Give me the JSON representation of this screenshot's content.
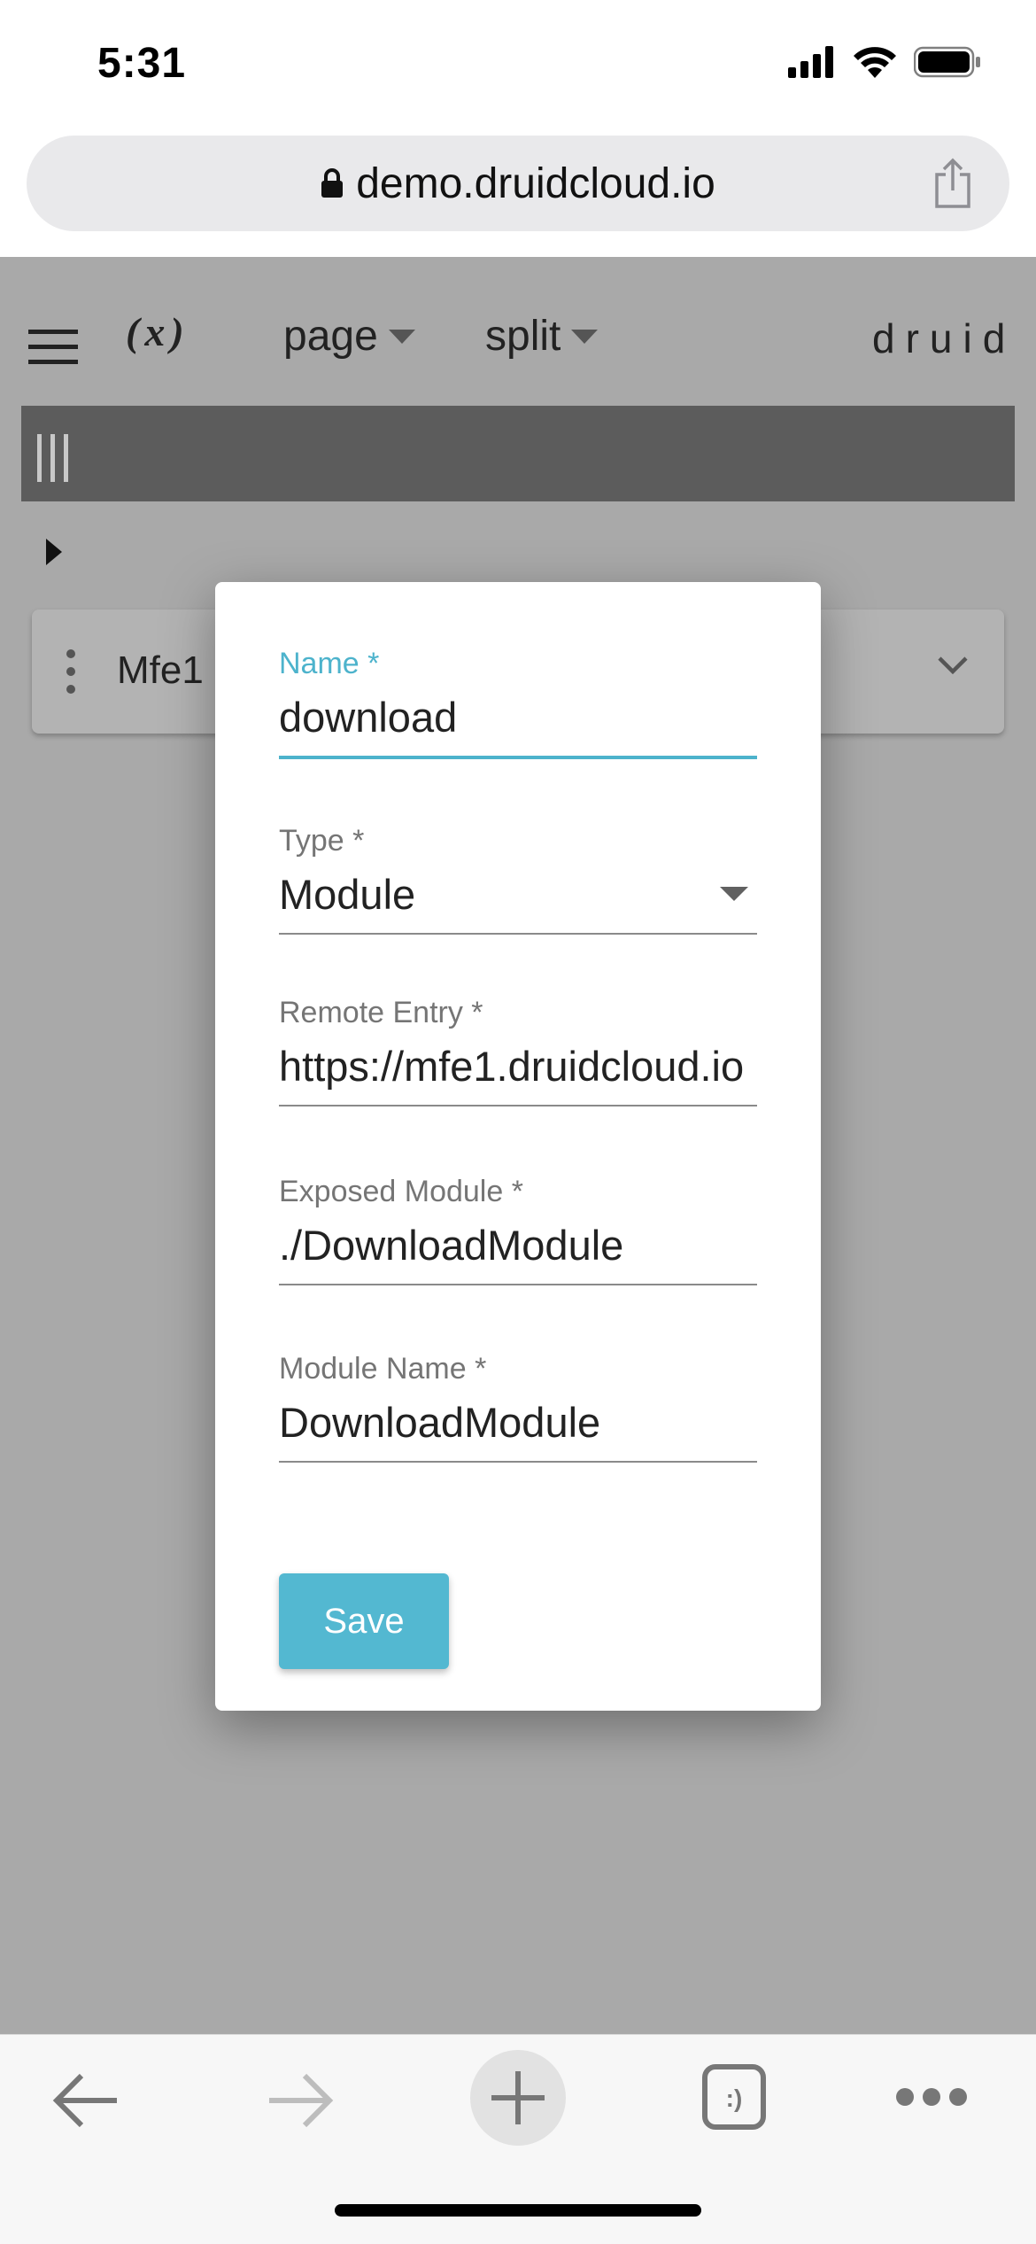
{
  "status_bar": {
    "time": "5:31"
  },
  "browser": {
    "url": "demo.druidcloud.io"
  },
  "app": {
    "toolbar": {
      "formula_label": "(x)",
      "page_menu": "page",
      "split_menu": "split",
      "brand": "druid"
    },
    "card": {
      "label": "Mfe1"
    }
  },
  "modal": {
    "fields": [
      {
        "label": "Name *",
        "value": "download"
      },
      {
        "label": "Type *",
        "value": "Module"
      },
      {
        "label": "Remote Entry *",
        "value": "https://mfe1.druidcloud.io"
      },
      {
        "label": "Exposed Module *",
        "value": "./DownloadModule"
      },
      {
        "label": "Module Name *",
        "value": "DownloadModule"
      }
    ],
    "save_label": "Save"
  },
  "colors": {
    "accent": "#4db3cc",
    "button": "#53b8d1",
    "overlay_gray": "#a9a9a9",
    "dark_bar": "#5c5c5c"
  },
  "icons": [
    "lock-icon",
    "share-icon",
    "menu-icon",
    "grip-icon",
    "caret-right-icon",
    "more-vert-icon",
    "chevron-down-icon",
    "back-arrow-icon",
    "forward-arrow-icon",
    "plus-icon",
    "tabs-icon",
    "more-horiz-icon"
  ]
}
